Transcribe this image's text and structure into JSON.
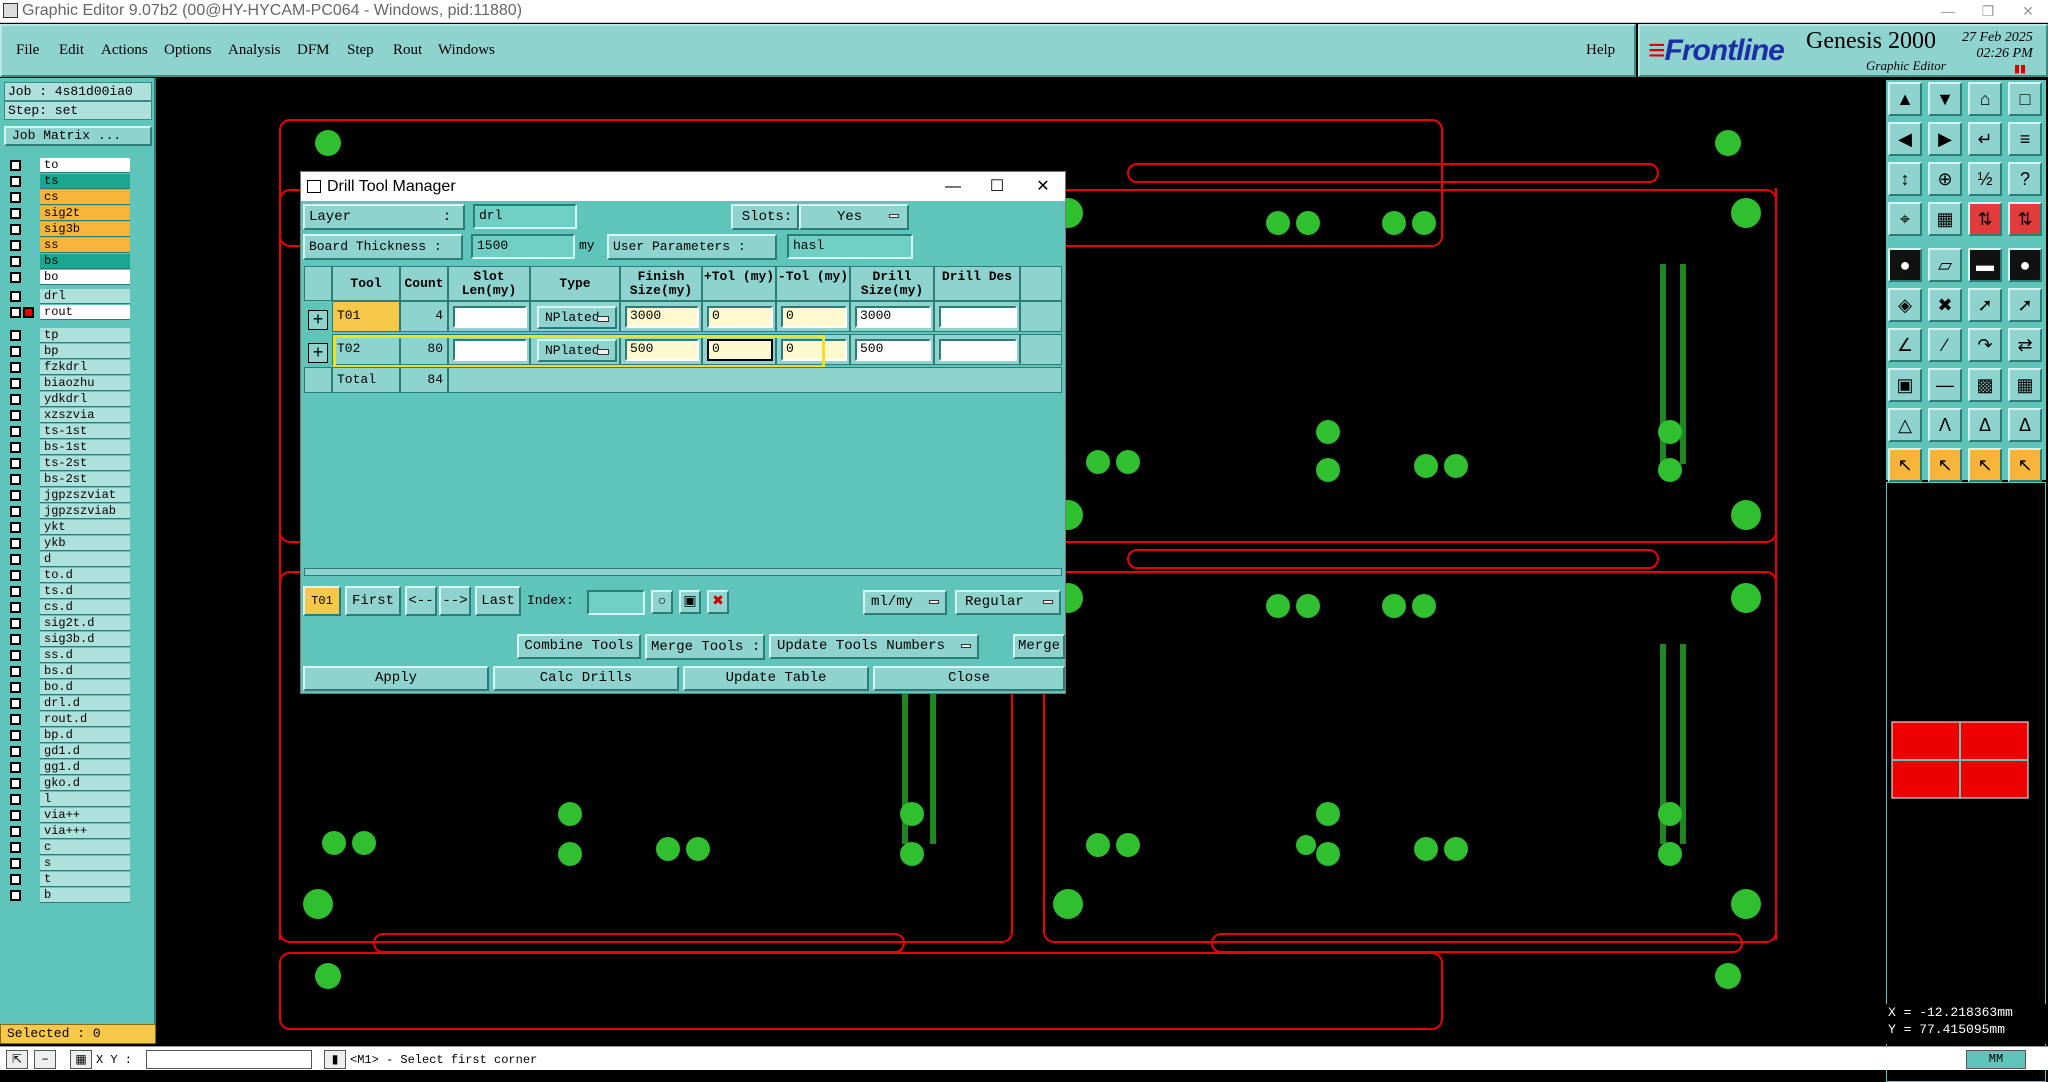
{
  "window": {
    "title": "Graphic Editor 9.07b2 (00@HY-HYCAM-PC064 - Windows, pid:11880)"
  },
  "menu": {
    "items": [
      "File",
      "Edit",
      "Actions",
      "Options",
      "Analysis",
      "DFM",
      "Step",
      "Rout",
      "Windows"
    ],
    "help": "Help"
  },
  "brand": {
    "logo": "Frontline",
    "product": "Genesis 2000",
    "subtitle": "Graphic Editor",
    "date": "27 Feb 2025",
    "time": "02:26 PM"
  },
  "job": {
    "job": "Job : 4s81d00ia0",
    "step": "Step: set",
    "matrix_button": "Job Matrix ..."
  },
  "layers_board": [
    {
      "name": "to",
      "color": "#ffffff"
    },
    {
      "name": "ts",
      "color": "#1aa68f"
    },
    {
      "name": "cs",
      "color": "#f6b43a"
    },
    {
      "name": "sig2t",
      "color": "#f6b43a"
    },
    {
      "name": "sig3b",
      "color": "#f6b43a"
    },
    {
      "name": "ss",
      "color": "#f6b43a"
    },
    {
      "name": "bs",
      "color": "#1aa68f"
    },
    {
      "name": "bo",
      "color": "#ffffff"
    }
  ],
  "layers_drill": [
    {
      "name": "drl",
      "color": "#aee0dc"
    },
    {
      "name": "rout",
      "color": "#ffffff"
    }
  ],
  "layers_misc": [
    "tp",
    "bp",
    "fzkdrl",
    "biaozhu",
    "ydkdrl",
    "xzszvia",
    "ts-1st",
    "bs-1st",
    "ts-2st",
    "bs-2st",
    "jgpzszviat",
    "jgpzszviab",
    "ykt",
    "ykb",
    "d",
    "to.d",
    "ts.d",
    "cs.d",
    "sig2t.d",
    "sig3b.d",
    "ss.d",
    "bs.d",
    "bo.d",
    "drl.d",
    "rout.d",
    "bp.d",
    "gd1.d",
    "gg1.d",
    "gko.d",
    "l",
    "via++",
    "via+++",
    "c",
    "s",
    "t",
    "b"
  ],
  "selected": "Selected : 0",
  "status": {
    "xy_label": "X Y :",
    "message": "<M1> - Select first corner",
    "units": "MM"
  },
  "coords": {
    "x": "X = -12.218363mm",
    "y": "Y = 77.415095mm"
  },
  "dialog": {
    "title": "Drill Tool Manager",
    "layer_label": "Layer",
    "layer_sep": ":",
    "layer_value": "drl",
    "slots_label": "Slots:",
    "slots_value": "Yes",
    "thickness_label": "Board Thickness :",
    "thickness_value": "1500",
    "thickness_unit": "my",
    "userparams_label": "User Parameters :",
    "userparams_value": "hasl",
    "columns": [
      "Tool",
      "Count",
      "Slot Len(my)",
      "Type",
      "Finish Size(my)",
      "+Tol (my)",
      "-Tol (my)",
      "Drill Size(my)",
      "Drill Des"
    ],
    "rows": [
      {
        "tool": "T01",
        "count": "4",
        "slot": "",
        "type": "NPlated",
        "finish": "3000",
        "ptol": "0",
        "ntol": "0",
        "drill": "3000",
        "des": ""
      },
      {
        "tool": "T02",
        "count": "80",
        "slot": "",
        "type": "NPlated",
        "finish": "500",
        "ptol": "0",
        "ntol": "0",
        "drill": "500",
        "des": ""
      }
    ],
    "total_label": "Total",
    "total_count": "84",
    "nav": {
      "current": "T01",
      "first": "First",
      "prev": "<--",
      "next": "-->",
      "last": "Last",
      "index_label": "Index:",
      "units": "ml/my",
      "mode": "Regular"
    },
    "actions": {
      "combine": "Combine Tools",
      "merge_label": "Merge Tools :",
      "update_numbers": "Update Tools Numbers",
      "merge": "Merge"
    },
    "buttons": {
      "apply": "Apply",
      "calc": "Calc Drills",
      "update": "Update Table",
      "close": "Close"
    }
  }
}
